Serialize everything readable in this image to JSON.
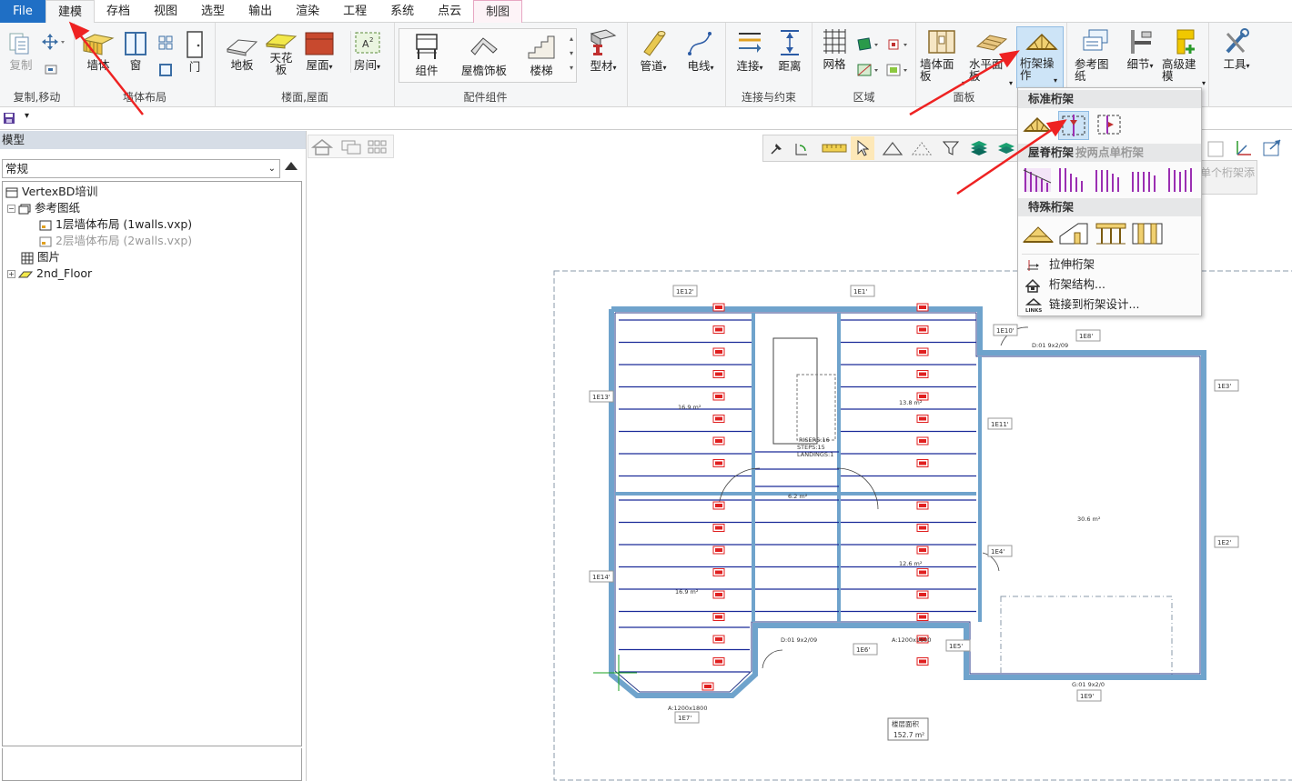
{
  "tabs": [
    "File",
    "建模",
    "存档",
    "视图",
    "选型",
    "输出",
    "渲染",
    "工程",
    "系统",
    "点云",
    "制图"
  ],
  "ribbon": {
    "groups": {
      "copy_move": "复制,移动",
      "wall_layout": "墙体布局",
      "floor_roof": "楼面,屋面",
      "components": "配件组件",
      "connect": "连接与约束",
      "region": "区域",
      "panel": "面板"
    },
    "buttons": {
      "copy": "复制",
      "wall": "墙体",
      "window": "窗",
      "door": "门",
      "floor": "地板",
      "ceiling": "天花板",
      "roof": "屋面",
      "room": "房间",
      "component": "组件",
      "eave": "屋檐饰板",
      "stairs": "楼梯",
      "profile": "型材",
      "pipe": "管道",
      "wire": "电线",
      "connect": "连接",
      "distance": "距离",
      "grid": "网格",
      "wall_panel": "墙体面板",
      "horizontal": "水平面板",
      "truss_op": "桁架操作",
      "ref_drawing": "参考图纸",
      "detail": "细节",
      "advanced": "高级建模",
      "tools": "工具"
    }
  },
  "panel": {
    "title": "模型",
    "combo_value": "常规",
    "tree": {
      "root": "VertexBD培训",
      "ref": "参考图纸",
      "ref1": "1层墙体布局 (1walls.vxp)",
      "ref2": "2层墙体布局 (2walls.vxp)",
      "pictures": "图片",
      "floor2": "2nd_Floor"
    }
  },
  "dropdown": {
    "standard": "标准桁架",
    "ridge": "屋脊桁架",
    "two_point": "按两点单桁架",
    "special": "特殊桁架",
    "stretch": "拉伸桁架",
    "structure": "桁架结构...",
    "link": "链接到桁架设计..."
  },
  "tooltip": "单个桁架添",
  "drawing": {
    "dims": [
      "1E12'",
      "1E1'",
      "1E13'",
      "1E14'",
      "1E6'",
      "1E7'",
      "1E8'",
      "1E9'",
      "1E5'",
      "1E3'",
      "1E2'",
      "1E10'",
      "1E11'",
      "1E4'"
    ],
    "area_label": "楼层面积",
    "area_value": "152.7 m²",
    "room_areas": [
      "16.9 m²",
      "6.2 m²",
      "13.8 m²",
      "12.6 m²",
      "30.6 m²",
      "16.9 m²"
    ],
    "stairs": "RISERS:16\nSTEPS:15\nLANDINGS:1",
    "openings": [
      "A:1200x1800",
      "D:01 9x2/09",
      "G:01 9x2/0",
      "A:1200x1600",
      "D:01 9x2/09",
      "D:0 1 9x2/09"
    ]
  },
  "colors": {
    "accent": "#1f6fc5",
    "wall": "#6fa3cc",
    "joist": "#1b2b99",
    "tag": "#e02020",
    "purple": "#9b2fb2",
    "arrow": "#ee2222"
  }
}
